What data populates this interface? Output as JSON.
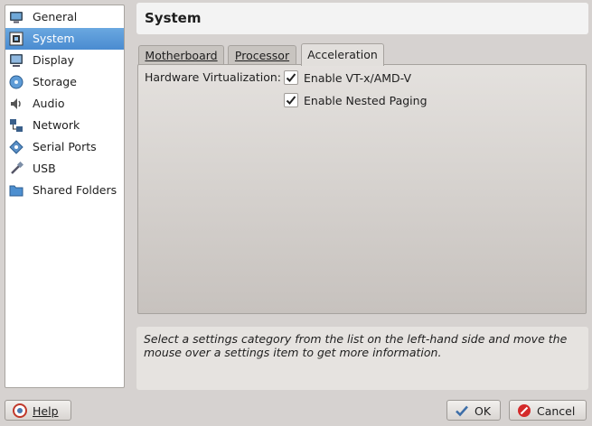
{
  "sidebar": {
    "items": [
      {
        "label": "General",
        "icon": "monitor-icon",
        "selected": false
      },
      {
        "label": "System",
        "icon": "chip-icon",
        "selected": true
      },
      {
        "label": "Display",
        "icon": "display-icon",
        "selected": false
      },
      {
        "label": "Storage",
        "icon": "disk-icon",
        "selected": false
      },
      {
        "label": "Audio",
        "icon": "speaker-icon",
        "selected": false
      },
      {
        "label": "Network",
        "icon": "network-icon",
        "selected": false
      },
      {
        "label": "Serial Ports",
        "icon": "serial-icon",
        "selected": false
      },
      {
        "label": "USB",
        "icon": "usb-icon",
        "selected": false
      },
      {
        "label": "Shared Folders",
        "icon": "folder-icon",
        "selected": false
      }
    ]
  },
  "header": {
    "title": "System"
  },
  "tabs": [
    {
      "label": "Motherboard",
      "active": false
    },
    {
      "label": "Processor",
      "active": false
    },
    {
      "label": "Acceleration",
      "active": true
    }
  ],
  "acceleration": {
    "hw_virt_label": "Hardware Virtualization:",
    "vtx_label": "Enable VT-x/AMD-V",
    "vtx_checked": true,
    "nested_label": "Enable Nested Paging",
    "nested_checked": true
  },
  "info_text": "Select a settings category from the list on the left-hand side and move the mouse over a settings item to get more information.",
  "buttons": {
    "help": "Help",
    "ok": "OK",
    "cancel": "Cancel"
  },
  "colors": {
    "selection": "#4a8bd0",
    "background": "#d6d2d0"
  }
}
